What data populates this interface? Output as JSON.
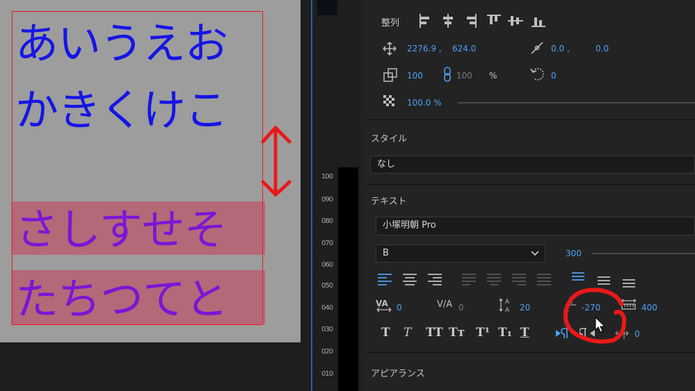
{
  "preview": {
    "lines": [
      "あいうえお",
      "かきくけこ",
      "さしすせそ",
      "たちつてと"
    ]
  },
  "timeline": {
    "ticks": [
      "100",
      "090",
      "080",
      "070",
      "060",
      "050",
      "040",
      "030",
      "020",
      "010"
    ]
  },
  "panel": {
    "align_label": "整列",
    "position": {
      "x": "2276.9 ,",
      "y": "624.0"
    },
    "anchor": {
      "x": "0.0 ,",
      "y": "0.0"
    },
    "scale": {
      "value": "100",
      "linked_value": "100",
      "unit": "%"
    },
    "rotation": "0",
    "opacity": "100.0 %",
    "style_label": "スタイル",
    "style_value": "なし",
    "text_label": "テキスト",
    "font_family": "小塚明朝 Pro",
    "font_style": "B",
    "font_size": "300",
    "kerning": "0",
    "tracking": "0",
    "leading": "20",
    "baseline_shift": "-270",
    "tsume": "400",
    "tab_width": "0",
    "tbuttons": [
      "T",
      "T",
      "TT",
      "Tт",
      "T¹",
      "T₁",
      "T"
    ],
    "appearance_label": "アピアランス"
  },
  "colors": {
    "accent": "#4ba3f5",
    "preview_text": "#1515e6",
    "preview_text_alt": "#7a16d6",
    "annotation": "#e8191a"
  }
}
